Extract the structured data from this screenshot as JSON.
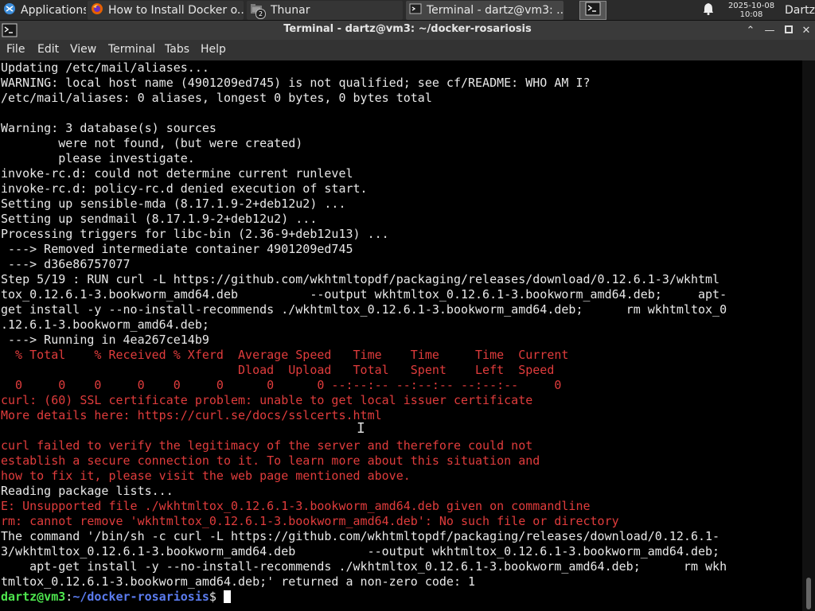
{
  "taskbar": {
    "applications_label": "Applications",
    "windows": [
      {
        "title": "How to Install Docker o..."
      },
      {
        "title": "Thunar",
        "badge": "2"
      },
      {
        "title": "Terminal - dartz@vm3: ..."
      }
    ],
    "date": "2025-10-08",
    "time": "10:08",
    "user": "Dartz"
  },
  "window": {
    "title": "Terminal - dartz@vm3: ~/docker-rosariosis"
  },
  "menu": {
    "items": [
      "File",
      "Edit",
      "View",
      "Terminal",
      "Tabs",
      "Help"
    ]
  },
  "terminal": {
    "lines": [
      {
        "text": "Updating /etc/mail/aliases...",
        "color": "white"
      },
      {
        "text": "WARNING: local host name (4901209ed745) is not qualified; see cf/README: WHO AM I?",
        "color": "white"
      },
      {
        "text": "/etc/mail/aliases: 0 aliases, longest 0 bytes, 0 bytes total",
        "color": "white"
      },
      {
        "text": "",
        "color": "white"
      },
      {
        "text": "Warning: 3 database(s) sources",
        "color": "white"
      },
      {
        "text": "        were not found, (but were created)",
        "color": "white"
      },
      {
        "text": "        please investigate.",
        "color": "white"
      },
      {
        "text": "invoke-rc.d: could not determine current runlevel",
        "color": "white"
      },
      {
        "text": "invoke-rc.d: policy-rc.d denied execution of start.",
        "color": "white"
      },
      {
        "text": "Setting up sensible-mda (8.17.1.9-2+deb12u2) ...",
        "color": "white"
      },
      {
        "text": "Setting up sendmail (8.17.1.9-2+deb12u2) ...",
        "color": "white"
      },
      {
        "text": "Processing triggers for libc-bin (2.36-9+deb12u13) ...",
        "color": "white"
      },
      {
        "text": " ---> Removed intermediate container 4901209ed745",
        "color": "white"
      },
      {
        "text": " ---> d36e86757077",
        "color": "white"
      },
      {
        "text": "Step 5/19 : RUN curl -L https://github.com/wkhtmltopdf/packaging/releases/download/0.12.6.1-3/wkhtml",
        "color": "white"
      },
      {
        "text": "tox_0.12.6.1-3.bookworm_amd64.deb          --output wkhtmltox_0.12.6.1-3.bookworm_amd64.deb;     apt-",
        "color": "white"
      },
      {
        "text": "get install -y --no-install-recommends ./wkhtmltox_0.12.6.1-3.bookworm_amd64.deb;      rm wkhtmltox_0",
        "color": "white"
      },
      {
        "text": ".12.6.1-3.bookworm_amd64.deb;",
        "color": "white"
      },
      {
        "text": " ---> Running in 4ea267ce14b9",
        "color": "white"
      },
      {
        "text": "  % Total    % Received % Xferd  Average Speed   Time    Time     Time  Current",
        "color": "red"
      },
      {
        "text": "                                 Dload  Upload   Total   Spent    Left  Speed",
        "color": "red"
      },
      {
        "text": "  0     0    0     0    0     0      0      0 --:--:-- --:--:-- --:--:--     0",
        "color": "red"
      },
      {
        "text": "curl: (60) SSL certificate problem: unable to get local issuer certificate",
        "color": "red"
      },
      {
        "text": "More details here: https://curl.se/docs/sslcerts.html",
        "color": "red"
      },
      {
        "text": "",
        "color": "red"
      },
      {
        "text": "curl failed to verify the legitimacy of the server and therefore could not",
        "color": "red"
      },
      {
        "text": "establish a secure connection to it. To learn more about this situation and",
        "color": "red"
      },
      {
        "text": "how to fix it, please visit the web page mentioned above.",
        "color": "red"
      },
      {
        "text": "Reading package lists...",
        "color": "white"
      },
      {
        "text": "E: Unsupported file ./wkhtmltox_0.12.6.1-3.bookworm_amd64.deb given on commandline",
        "color": "red"
      },
      {
        "text": "rm: cannot remove 'wkhtmltox_0.12.6.1-3.bookworm_amd64.deb': No such file or directory",
        "color": "red"
      },
      {
        "text": "The command '/bin/sh -c curl -L https://github.com/wkhtmltopdf/packaging/releases/download/0.12.6.1-",
        "color": "white"
      },
      {
        "text": "3/wkhtmltox_0.12.6.1-3.bookworm_amd64.deb          --output wkhtmltox_0.12.6.1-3.bookworm_amd64.deb;",
        "color": "white"
      },
      {
        "text": "    apt-get install -y --no-install-recommends ./wkhtmltox_0.12.6.1-3.bookworm_amd64.deb;      rm wkh",
        "color": "white"
      },
      {
        "text": "tmltox_0.12.6.1-3.bookworm_amd64.deb;' returned a non-zero code: 1",
        "color": "white"
      }
    ],
    "prompt_user": "dartz@vm3",
    "prompt_sep": ":",
    "prompt_path": "~/docker-rosariosis",
    "prompt_symbol": "$ "
  },
  "colors": {
    "background": "#000000",
    "text": "#e8e8e8",
    "error": "#e03c3c",
    "prompt_user": "#4ee64e",
    "prompt_path": "#5b7cf0"
  }
}
